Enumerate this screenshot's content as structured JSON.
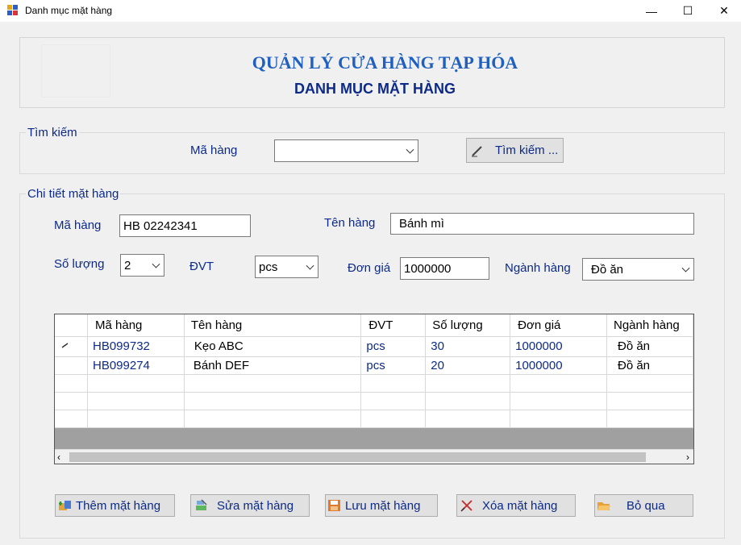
{
  "window": {
    "title": "Danh mục mặt hàng",
    "minimize": "—",
    "maximize": "☐",
    "close": "✕"
  },
  "header": {
    "title": "QUẢN LÝ CỬA HÀNG TẠP HÓA",
    "subtitle": "DANH MỤC MẶT HÀNG"
  },
  "search": {
    "group_label": "Tìm kiếm",
    "field_label": "Mã hàng",
    "value": "",
    "button_label": "Tìm kiếm ..."
  },
  "detail": {
    "group_label": "Chi tiết mặt hàng",
    "ma_hang_label": "Mã hàng",
    "ma_hang_value": "HB 02242341",
    "ten_hang_label": "Tên hàng",
    "ten_hang_value": "Bánh mì",
    "so_luong_label": "Số lượng",
    "so_luong_value": "2",
    "dvt_label": "ĐVT",
    "dvt_value": "pcs",
    "don_gia_label": "Đơn giá",
    "don_gia_value": "1000000",
    "nganh_hang_label": "Ngành hàng",
    "nganh_hang_value": "Đồ ăn"
  },
  "table": {
    "columns": [
      "Mã hàng",
      "Tên hàng",
      "ĐVT",
      "Số lượng",
      "Đơn giá",
      "Ngành hàng"
    ],
    "rows": [
      [
        "HB099732",
        "Kẹo ABC",
        "pcs",
        "30",
        "1000000",
        "Đồ ăn"
      ],
      [
        "HB099274",
        "Bánh DEF",
        "pcs",
        "20",
        "1000000",
        "Đồ ăn"
      ],
      [
        "",
        "",
        "",
        "",
        "",
        ""
      ],
      [
        "",
        "",
        "",
        "",
        "",
        ""
      ],
      [
        "",
        "",
        "",
        "",
        "",
        ""
      ]
    ]
  },
  "buttons": {
    "add": "Thêm mặt hàng",
    "edit": "Sửa mặt hàng",
    "save": "Lưu mặt hàng",
    "delete": "Xóa mặt hàng",
    "cancel": "Bỏ qua"
  },
  "colors": {
    "label_blue": "#0c2a86",
    "title_blue": "#1f5fbf"
  }
}
